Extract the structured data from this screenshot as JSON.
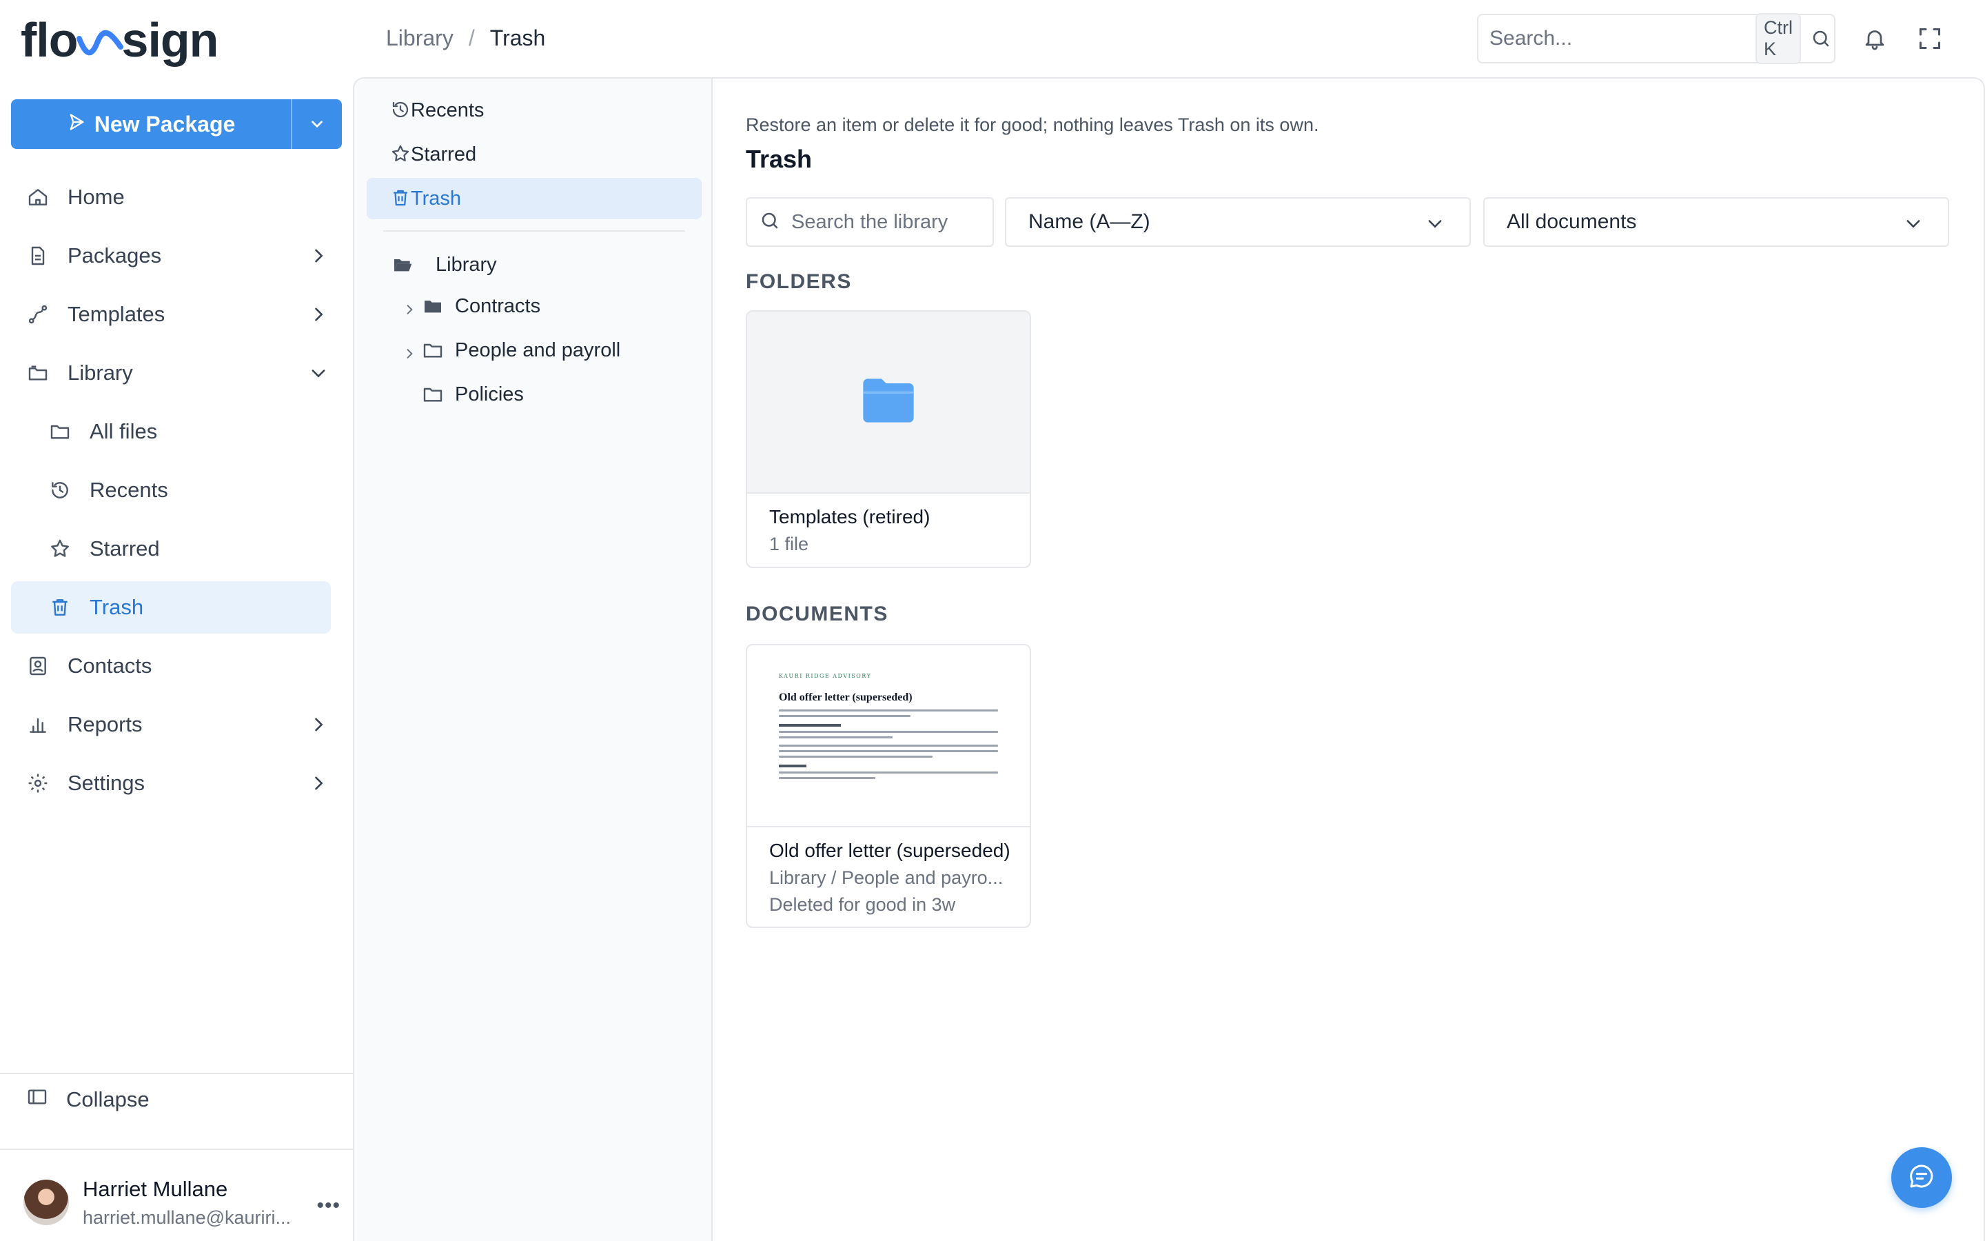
{
  "app": {
    "logo_text_a": "flo",
    "logo_text_b": "sign"
  },
  "breadcrumb": {
    "parent": "Library",
    "separator": "/",
    "current": "Trash"
  },
  "topbar": {
    "search_placeholder": "Search...",
    "shortcut": "Ctrl K"
  },
  "sidebar": {
    "new_package_label": "New Package",
    "items": [
      {
        "label": "Home",
        "icon": "home-icon"
      },
      {
        "label": "Packages",
        "icon": "document-icon"
      },
      {
        "label": "Templates",
        "icon": "templates-icon"
      },
      {
        "label": "Library",
        "icon": "library-icon"
      },
      {
        "label": "All files",
        "icon": "folder-icon"
      },
      {
        "label": "Recents",
        "icon": "history-icon"
      },
      {
        "label": "Starred",
        "icon": "star-icon"
      },
      {
        "label": "Trash",
        "icon": "trash-icon"
      },
      {
        "label": "Contacts",
        "icon": "contacts-icon"
      },
      {
        "label": "Reports",
        "icon": "reports-icon"
      },
      {
        "label": "Settings",
        "icon": "gear-icon"
      }
    ],
    "collapse_label": "Collapse",
    "user": {
      "name": "Harriet Mullane",
      "email": "harriet.mullane@kauriri..."
    }
  },
  "panel": {
    "quick": [
      "Recents",
      "Starred",
      "Trash"
    ],
    "tree": {
      "root": "Library",
      "children": [
        "Contracts",
        "People and payroll",
        "Policies"
      ]
    }
  },
  "main": {
    "hint": "Restore an item or delete it for good; nothing leaves Trash on its own.",
    "title": "Trash",
    "search_placeholder": "Search the library",
    "sort_value": "Name (A—Z)",
    "filter_value": "All documents",
    "folders_label": "FOLDERS",
    "documents_label": "DOCUMENTS",
    "folders": [
      {
        "name": "Templates (retired)",
        "meta": "1 file"
      }
    ],
    "documents": [
      {
        "name": "Old offer letter (superseded)",
        "path": "Library / People and payro...",
        "status": "Deleted for good in 3w",
        "preview": {
          "org": "KAURI RIDGE ADVISORY",
          "title": "Old offer letter (superseded)"
        }
      }
    ]
  },
  "colors": {
    "accent": "#3b8fea",
    "active_bg": "#e8f2fd",
    "active_text": "#2b78d1",
    "folder": "#5aa6f5"
  }
}
